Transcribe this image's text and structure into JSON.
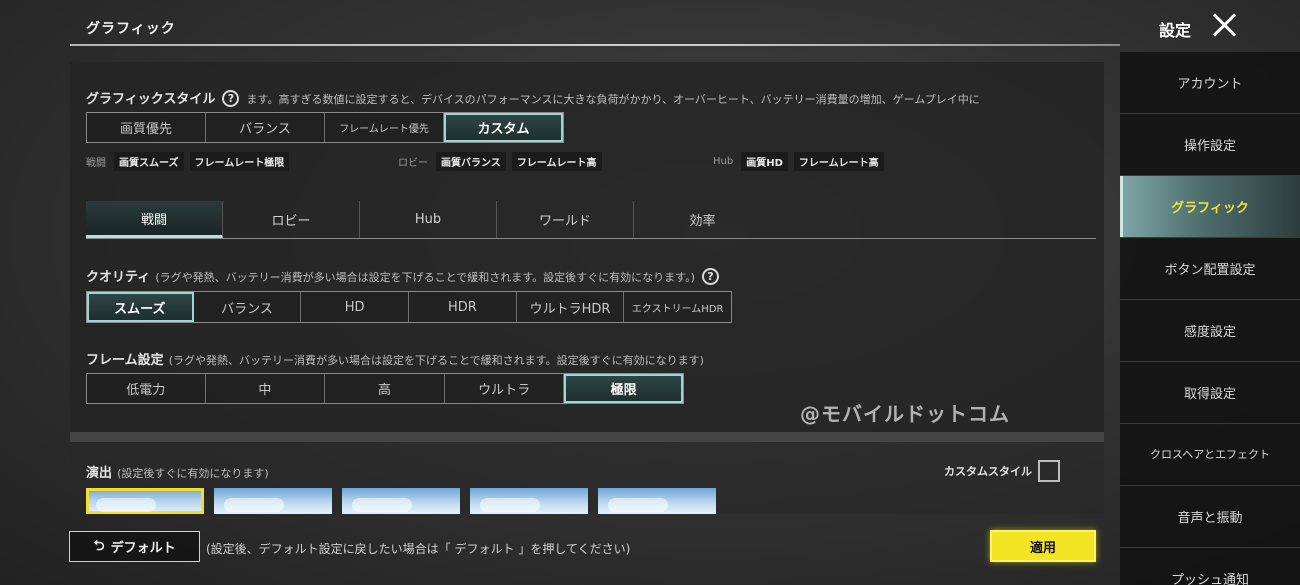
{
  "header": {
    "page_title": "グラフィック",
    "settings_title": "設定"
  },
  "sidebar": {
    "items": [
      {
        "label": "アカウント"
      },
      {
        "label": "操作設定"
      },
      {
        "label": "グラフィック"
      },
      {
        "label": "ボタン配置設定"
      },
      {
        "label": "感度設定"
      },
      {
        "label": "取得設定"
      },
      {
        "label": "クロスヘアとエフェクト"
      },
      {
        "label": "音声と振動"
      },
      {
        "label": "プッシュ通知"
      }
    ],
    "active_index": 2
  },
  "graphics_style": {
    "label": "グラフィックスタイル",
    "note": "ます。高すぎる数値に設定すると、デバイスのパフォーマンスに大きな負荷がかかり、オーバーヒート、バッテリー消費量の増加、ゲームプレイ中に",
    "options": [
      "画質優先",
      "バランス",
      "フレームレート優先",
      "カスタム"
    ],
    "selected": "カスタム"
  },
  "presets": [
    {
      "label": "戦闘",
      "quality": "画質スムーズ",
      "frame": "フレームレート極限"
    },
    {
      "label": "ロビー",
      "quality": "画質バランス",
      "frame": "フレームレート高"
    },
    {
      "label": "Hub",
      "quality": "画質HD",
      "frame": "フレームレート高"
    }
  ],
  "tabs": {
    "items": [
      "戦闘",
      "ロビー",
      "Hub",
      "ワールド",
      "効率"
    ],
    "active": "戦闘"
  },
  "quality": {
    "label": "クオリティ",
    "note": "(ラグや発熱、バッテリー消費が多い場合は設定を下げることで緩和されます。設定後すぐに有効になります。)",
    "options": [
      "スムーズ",
      "バランス",
      "HD",
      "HDR",
      "ウルトラHDR",
      "エクストリームHDR"
    ],
    "selected": "スムーズ"
  },
  "frame": {
    "label": "フレーム設定",
    "note": "(ラグや発熱、バッテリー消費が多い場合は設定を下げることで緩和されます。設定後すぐに有効になります)",
    "options": [
      "低電力",
      "中",
      "高",
      "ウルトラ",
      "極限"
    ],
    "selected": "極限"
  },
  "watermark": "@モバイルドットコム",
  "effects": {
    "label": "演出",
    "note": "(設定後すぐに有効になります)",
    "custom_style_label": "カスタムスタイル"
  },
  "footer": {
    "default_label": "デフォルト",
    "default_note": "(設定後、デフォルト設定に戻したい場合は「 デフォルト 」を押してください)",
    "apply_label": "適用"
  },
  "colors": {
    "accent_yellow": "#f3e524",
    "active_teal": "#9ed6d2"
  }
}
